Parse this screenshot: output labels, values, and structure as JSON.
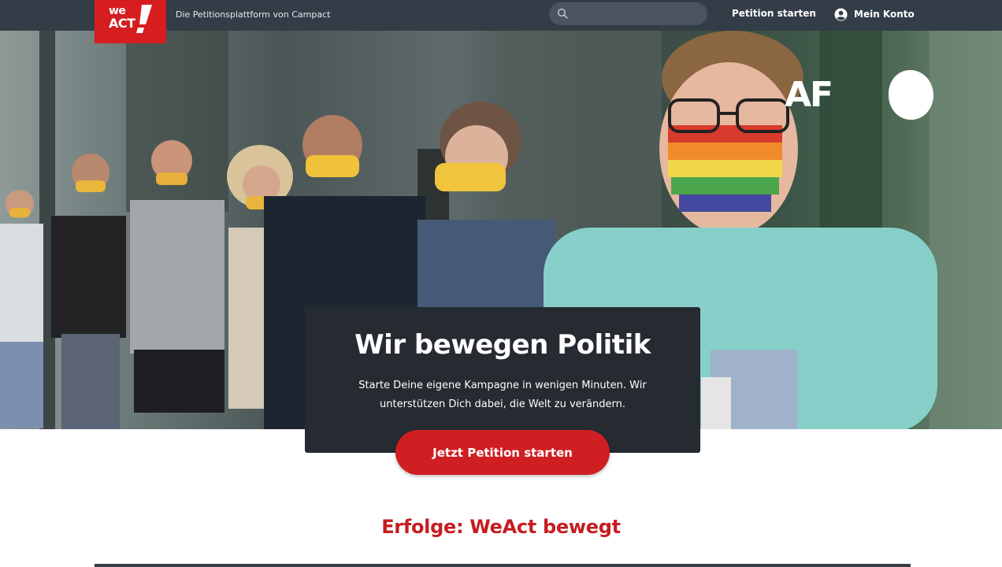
{
  "header": {
    "logo": {
      "line1": "we",
      "line2": "ACT",
      "brand_color": "#d61d1f"
    },
    "tagline": "Die Petitionsplattform von Campact",
    "search": {
      "placeholder": "",
      "icon": "search-icon"
    },
    "start_petition_label": "Petition starten",
    "account": {
      "label": "Mein Konto",
      "icon": "user-icon"
    }
  },
  "hero": {
    "watermark": "AF",
    "title": "Wir bewegen Politik",
    "subtitle": "Starte Deine eigene Kampagne in wenigen Minuten. Wir unterstützen Dich dabei, die Welt zu verändern.",
    "cta_label": "Jetzt Petition starten"
  },
  "successes": {
    "heading": "Erfolge: WeAct bewegt"
  },
  "colors": {
    "nav_bg": "#333d47",
    "accent_red": "#cf1f23",
    "card_bg": "#262a31",
    "heading_red": "#c51d22"
  }
}
